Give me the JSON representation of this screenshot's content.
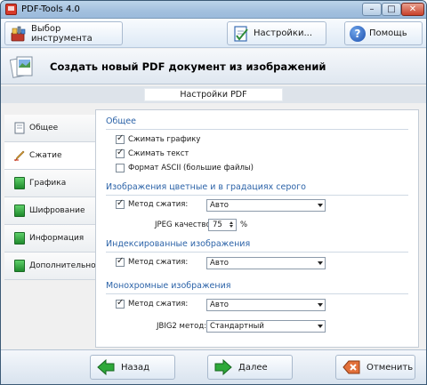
{
  "window": {
    "title": "PDF-Tools 4.0",
    "controls": {
      "minimize": "–",
      "maximize": "□",
      "close": "✕"
    }
  },
  "toolbar": {
    "select_tool_label": "Выбор инструмента",
    "settings_label": "Настройки...",
    "help_label": "Помощь",
    "help_glyph": "?"
  },
  "header": {
    "title": "Создать новый PDF документ из изображений"
  },
  "section": {
    "title": "Настройки PDF"
  },
  "nav": {
    "items": [
      {
        "label": "Общее",
        "icon": "general-doc-icon"
      },
      {
        "label": "Сжатие",
        "icon": "compression-pencil-icon",
        "active": true
      },
      {
        "label": "Графика",
        "icon": "graphics-icon"
      },
      {
        "label": "Шифрование",
        "icon": "encryption-icon"
      },
      {
        "label": "Информация",
        "icon": "information-icon"
      },
      {
        "label": "Дополнительно",
        "icon": "advanced-icon"
      }
    ]
  },
  "general": {
    "heading": "Общее",
    "compress_graphics": {
      "label": "Сжимать графику",
      "checked": true
    },
    "compress_text": {
      "label": "Сжимать текст",
      "checked": true
    },
    "ascii_format": {
      "label": "Формат ASCII (большие файлы)",
      "checked": false
    }
  },
  "color_images": {
    "heading": "Изображения цветные и в градациях серого",
    "method_label": "Метод сжатия:",
    "method_value": "Авто",
    "jpeg_label": "JPEG качество:",
    "jpeg_value": "75",
    "jpeg_unit": "%"
  },
  "indexed_images": {
    "heading": "Индексированные изображения",
    "method_label": "Метод сжатия:",
    "method_value": "Авто"
  },
  "mono_images": {
    "heading": "Монохромные изображения",
    "method_label": "Метод сжатия:",
    "method_value": "Авто",
    "jbig2_label": "JBIG2 метод:",
    "jbig2_value": "Стандартный"
  },
  "footer": {
    "back_label": "Назад",
    "next_label": "Далее",
    "cancel_label": "Отменить"
  },
  "colors": {
    "accent_heading": "#2c63a8",
    "green_arrow": "#2ea93a",
    "cancel_orange": "#e2703a"
  }
}
